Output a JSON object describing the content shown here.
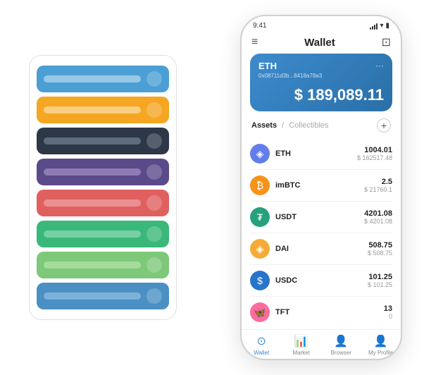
{
  "phone": {
    "status_time": "9:41",
    "title": "Wallet",
    "eth_card": {
      "label": "ETH",
      "address": "0x08711d3b...8418a78a3",
      "amount": "$ 189,089.11",
      "currency_symbol": "$",
      "more_icon": "···"
    },
    "assets_section": {
      "active_tab": "Assets",
      "separator": "/",
      "inactive_tab": "Collectibles",
      "add_label": "+"
    },
    "assets": [
      {
        "name": "ETH",
        "icon": "◈",
        "icon_color": "#627EEA",
        "amount": "1004.01",
        "usd": "$ 162517.48"
      },
      {
        "name": "imBTC",
        "icon": "⊕",
        "icon_color": "#F7931A",
        "amount": "2.5",
        "usd": "$ 21760.1"
      },
      {
        "name": "USDT",
        "icon": "₮",
        "icon_color": "#26A17B",
        "amount": "4201.08",
        "usd": "$ 4201.08"
      },
      {
        "name": "DAI",
        "icon": "◈",
        "icon_color": "#F5AC37",
        "amount": "508.75",
        "usd": "$ 508.75"
      },
      {
        "name": "USDC",
        "icon": "⊙",
        "icon_color": "#2775CA",
        "amount": "101.25",
        "usd": "$ 101.25"
      },
      {
        "name": "TFT",
        "icon": "🦋",
        "icon_color": "#FF6B9D",
        "amount": "13",
        "usd": "0"
      }
    ],
    "nav": [
      {
        "label": "Wallet",
        "icon": "⊙",
        "active": true
      },
      {
        "label": "Market",
        "icon": "📈",
        "active": false
      },
      {
        "label": "Browser",
        "icon": "🌐",
        "active": false
      },
      {
        "label": "My Profile",
        "icon": "👤",
        "active": false
      }
    ]
  },
  "card_stack": {
    "rows": [
      {
        "color": "blue",
        "bar_color": "bar-blue"
      },
      {
        "color": "orange",
        "bar_color": "bar-orange"
      },
      {
        "color": "dark",
        "bar_color": "bar-dark"
      },
      {
        "color": "purple",
        "bar_color": "bar-purple"
      },
      {
        "color": "red",
        "bar_color": "bar-red"
      },
      {
        "color": "green",
        "bar_color": "bar-green"
      },
      {
        "color": "light-green",
        "bar_color": "bar-light-green"
      },
      {
        "color": "steel-blue",
        "bar_color": "bar-steel"
      }
    ]
  }
}
